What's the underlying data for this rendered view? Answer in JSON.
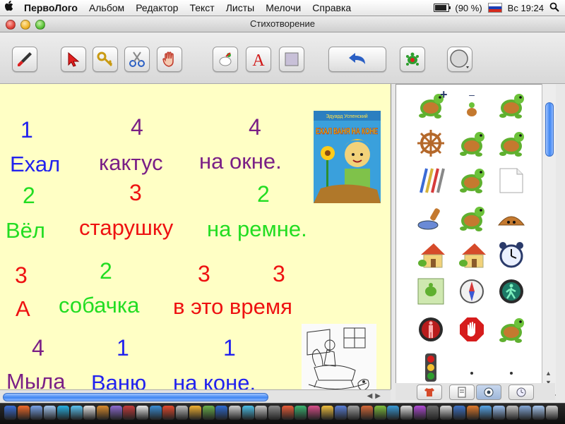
{
  "menubar": {
    "apple": "",
    "items": [
      "ПервоЛого",
      "Альбом",
      "Редактор",
      "Текст",
      "Листы",
      "Мелочи",
      "Справка"
    ],
    "battery": "(90 %)",
    "battery_level": 0.9,
    "clock": "Вс 19:24"
  },
  "window": {
    "title": "Стихотворение"
  },
  "toolbar": {
    "buttons": [
      "brush-tool",
      "pointer-tool",
      "key-tool",
      "scissors-tool",
      "hand-tool",
      "turtle-paint-tool",
      "text-tool",
      "shape-tool",
      "undo-button",
      "turtle-button",
      "color-picker"
    ]
  },
  "page": {
    "rows": [
      {
        "nums": [
          "1",
          "4",
          "4"
        ],
        "words": [
          "Ехал",
          "кактус",
          "на окне."
        ]
      },
      {
        "nums": [
          "2",
          "3",
          "2"
        ],
        "words": [
          "Вёл",
          "старушку",
          "на ремне."
        ]
      },
      {
        "nums": [
          "3",
          "2",
          "3",
          "3"
        ],
        "words": [
          "А",
          "собачка",
          "в это время"
        ]
      },
      {
        "nums": [
          "4",
          "1",
          "1"
        ],
        "words": [
          "Мыла",
          "Ваню",
          "на коне."
        ]
      }
    ],
    "colors": {
      "blue": "#2222ee",
      "purple": "#7a1f86",
      "green": "#22dd22",
      "red": "#ee1111"
    },
    "book_cover": {
      "author": "Эдуард Успенский",
      "title": "ЕХАЛ ВАНЯ НА КОНЕ"
    }
  },
  "palette": {
    "tabs": [
      "shirt-tab",
      "page-tab",
      "shapes-tab",
      "melody-tab"
    ],
    "active_tab": "shapes-tab"
  },
  "dock": {
    "colors": [
      "#3b6ed6",
      "#f06a2a",
      "#7aa3e8",
      "#a7c9f2",
      "#28b0e3",
      "#5cc4f2",
      "#e6e6e6",
      "#d98b2e",
      "#8e6bd1",
      "#c43c3c",
      "#e8e8e8",
      "#3b8ed6",
      "#e34a2e",
      "#bcbcbc",
      "#f2b233",
      "#6ab04c",
      "#2f6bd1",
      "#d1d1d1",
      "#4cc0e8",
      "#c8c8c8",
      "#8a8a8a",
      "#e85d3a",
      "#3cb371",
      "#d94f8a",
      "#f0c040",
      "#5a7fd6",
      "#a0a0a0",
      "#d66a3a",
      "#7fbf3f",
      "#3a9ad6",
      "#e0e0e0",
      "#b04cd6",
      "#6d6d6d",
      "#dcdcdc",
      "#3f74c7",
      "#e07b2e",
      "#58a6e8",
      "#9ac0f0",
      "#c0c0c0",
      "#86a8d8",
      "#a8c8f0",
      "#cfcfcf"
    ]
  }
}
